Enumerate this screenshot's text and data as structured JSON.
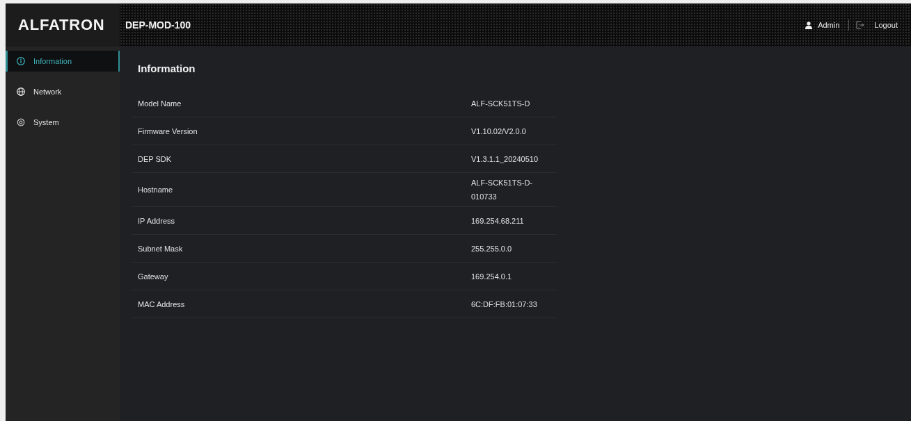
{
  "header": {
    "logo": "ALFATRON",
    "title": "DEP-MOD-100",
    "user": "Admin",
    "logout": "Logout"
  },
  "sidebar": {
    "items": [
      {
        "label": "Information",
        "selected": true
      },
      {
        "label": "Network",
        "selected": false
      },
      {
        "label": "System",
        "selected": false
      }
    ]
  },
  "panel": {
    "title": "Information",
    "rows": [
      {
        "label": "Model Name",
        "value": "ALF-SCK51TS-D"
      },
      {
        "label": "Firmware Version",
        "value": "V1.10.02/V2.0.0"
      },
      {
        "label": "DEP SDK",
        "value": "V1.3.1.1_20240510"
      },
      {
        "label": "Hostname",
        "value": "ALF-SCK51TS-D-010733"
      },
      {
        "label": "IP Address",
        "value": "169.254.68.211"
      },
      {
        "label": "Subnet Mask",
        "value": "255.255.0.0"
      },
      {
        "label": "Gateway",
        "value": "169.254.0.1"
      },
      {
        "label": "MAC Address",
        "value": "6C:DF:FB:01:07:33"
      }
    ]
  }
}
